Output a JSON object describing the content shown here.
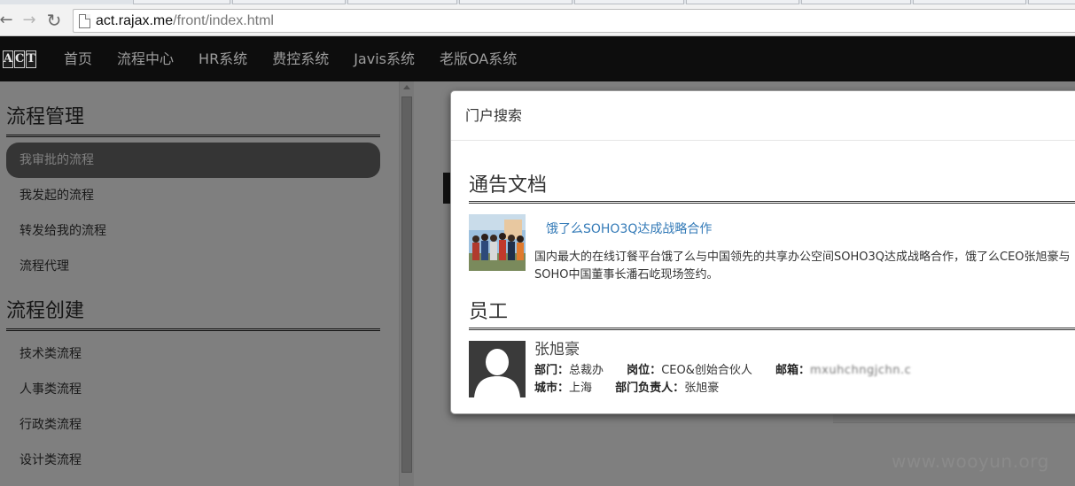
{
  "browser": {
    "url_host": "act.rajax.me",
    "url_path": "/front/index.html"
  },
  "navbar": {
    "brand_letters": [
      "A",
      "C",
      "T"
    ],
    "links": [
      "首页",
      "流程中心",
      "HR系统",
      "费控系统",
      "Javis系统",
      "老版OA系统"
    ]
  },
  "sidebar": {
    "section1_title": "流程管理",
    "section1_items": [
      "我审批的流程",
      "我发起的流程",
      "转发给我的流程",
      "流程代理"
    ],
    "section2_title": "流程创建",
    "section2_items": [
      "技术类流程",
      "人事类流程",
      "行政类流程",
      "设计类流程"
    ],
    "active_item": "我审批的流程"
  },
  "modal": {
    "title": "门户搜索",
    "notice_section": "通告文档",
    "notice_link": "饿了么SOHO3Q达成战略合作",
    "notice_desc": "国内最大的在线订餐平台饿了么与中国领先的共享办公空间SOHO3Q达成战略合作，饿了么CEO张旭豪与SOHO中国董事长潘石屹现场签约。",
    "employee_section": "员工",
    "employee": {
      "name": "张旭豪",
      "dept_label": "部门：",
      "dept": "总裁办",
      "position_label": "岗位：",
      "position": "CEO&创始合伙人",
      "email_label": "邮箱：",
      "email": "mxuhchngjchn.c",
      "city_label": "城市：",
      "city": "上海",
      "manager_label": "部门负责人：",
      "manager": "张旭豪"
    }
  },
  "watermark": "www.wooyun.org",
  "colors": {
    "navbar_bg": "#0d0d0d",
    "link_blue": "#337ab7",
    "active_item_bg": "#6a6a6a"
  }
}
